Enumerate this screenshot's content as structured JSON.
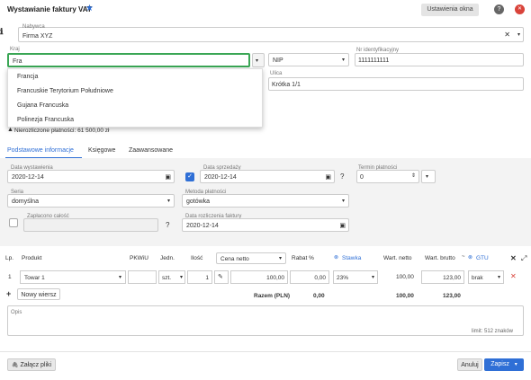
{
  "header": {
    "title": "Wystawianie faktury VAT",
    "settings_btn": "Ustawienia okna",
    "help": "?",
    "close": "✕"
  },
  "nabywca": {
    "label": "Nabywca",
    "value": "Firma XYZ"
  },
  "kraj": {
    "label": "Kraj",
    "value": "Fra"
  },
  "dropdown": [
    "Francja",
    "Francuskie Terytorium Południowe",
    "Gujana Francuska",
    "Polinezja Francuska"
  ],
  "nip": {
    "type": "NIP",
    "label": "Nr identyfikacyjny",
    "value": "1111111111"
  },
  "ulica": {
    "label": "Ulica",
    "value": "Krótka 1/1"
  },
  "warning": "Nierozliczone płatności: 61 500,00 zł",
  "tabs": [
    "Podstawowe informacje",
    "Księgowe",
    "Zaawansowane"
  ],
  "basic": {
    "data_wyst_label": "Data wystawienia",
    "data_wyst": "2020-12-14",
    "data_sprz_label": "Data sprzedaży",
    "data_sprz": "2020-12-14",
    "termin_label": "Termin płatności",
    "termin": "0",
    "seria_label": "Seria",
    "seria": "domyślna",
    "metoda_label": "Metoda płatności",
    "metoda": "gotówka",
    "zaplacono_label": "Zapłacono całość",
    "data_rozl_label": "Data rozliczenia faktury",
    "data_rozl": "2020-12-14",
    "q": "?"
  },
  "table": {
    "headers": {
      "lp": "Lp.",
      "produkt": "Produkt",
      "pkwiu": "PKWiU",
      "jedn": "Jedn.",
      "ilosc": "Ilość",
      "cena": "Cena netto",
      "rabat": "Rabat %",
      "stawka": "Stawka",
      "wart_netto": "Wart. netto",
      "wart_brutto": "Wart. brutto",
      "gtu": "GTU"
    },
    "row": {
      "lp": "1",
      "produkt": "Towar 1",
      "pkwiu": "",
      "jedn": "szt.",
      "ilosc": "1",
      "cena": "100,00",
      "rabat": "0,00",
      "stawka": "23%",
      "wart_netto": "100,00",
      "wart_brutto": "123,00",
      "gtu": "brak"
    },
    "add_row": "Nowy wiersz",
    "sum_label": "Razem (PLN)",
    "sum_rabat": "0,00",
    "sum_netto": "100,00",
    "sum_brutto": "123,00"
  },
  "opis": {
    "label": "Opis",
    "limit": "limit: 512 znaków"
  },
  "footer": {
    "attach": "Załącz pliki",
    "cancel": "Anuluj",
    "save": "Zapisz"
  },
  "colors": {
    "primary": "#2f6fd6",
    "accent_green": "#3aa655",
    "close_red": "#d9433a"
  }
}
